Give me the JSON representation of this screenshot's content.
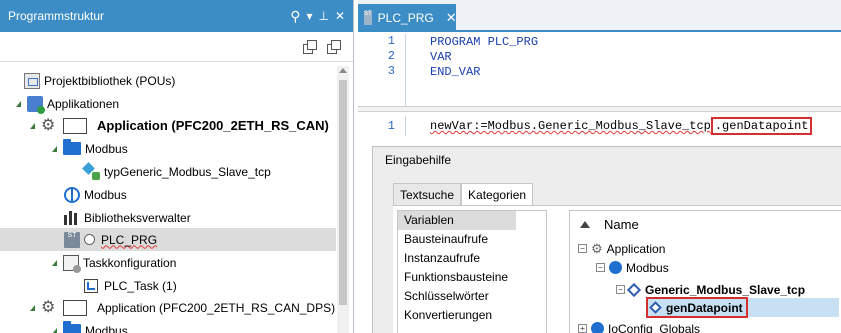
{
  "left_panel": {
    "title": "Programmstruktur",
    "header_tools": {
      "search_icon": "search-icon",
      "dropdown": "▾",
      "pin": "⊥",
      "close": "✕"
    },
    "tree": [
      {
        "label": "Projektbibliothek (POUs)",
        "icon": "project-library-icon"
      },
      {
        "label": "Applikationen",
        "icon": "applications-icon"
      },
      {
        "label": "Application (PFC200_2ETH_RS_CAN)",
        "icon": "gear-icon"
      },
      {
        "label": "Modbus",
        "icon": "folder-icon"
      },
      {
        "label": "typGeneric_Modbus_Slave_tcp",
        "icon": "module-type-icon"
      },
      {
        "label": "Modbus",
        "icon": "globe-icon"
      },
      {
        "label": "Bibliotheksverwalter",
        "icon": "library-manager-icon"
      },
      {
        "label": "PLC_PRG",
        "icon": "st-program-icon"
      },
      {
        "label": "Taskkonfiguration",
        "icon": "task-config-icon"
      },
      {
        "label": "PLC_Task (1)",
        "icon": "task-icon"
      },
      {
        "label": "Application (PFC200_2ETH_RS_CAN_DPS)",
        "icon": "gear-icon"
      },
      {
        "label": "Modbus",
        "icon": "folder-icon"
      }
    ]
  },
  "editor": {
    "tab_label": "PLC_PRG",
    "tab_icon_text": "ST",
    "declarations": [
      {
        "line": "1",
        "text": "PROGRAM PLC_PRG"
      },
      {
        "line": "2",
        "text": "VAR"
      },
      {
        "line": "3",
        "text": "END_VAR"
      }
    ],
    "impl_line": "1",
    "impl_prefix": "newVar:=Modbus.Generic_Modbus_Slave_tcp",
    "impl_highlight": ".genDatapoint"
  },
  "dialog": {
    "title": "Eingabehilfe",
    "tabs": [
      "Textsuche",
      "Kategorien"
    ],
    "categories": [
      "Variablen",
      "Bausteinaufrufe",
      "Instanzaufrufe",
      "Funktionsbausteine",
      "Schlüsselwörter",
      "Konvertierungen"
    ],
    "tree_header": "Name",
    "tree": [
      {
        "label": "Application"
      },
      {
        "label": "Modbus"
      },
      {
        "label": "Generic_Modbus_Slave_tcp"
      },
      {
        "label": "genDatapoint"
      },
      {
        "label": "IoConfig_Globals"
      }
    ]
  },
  "colors": {
    "accent": "#3c8dc5",
    "highlight_red": "#d32f2f",
    "selection": "#c7e0f4"
  }
}
